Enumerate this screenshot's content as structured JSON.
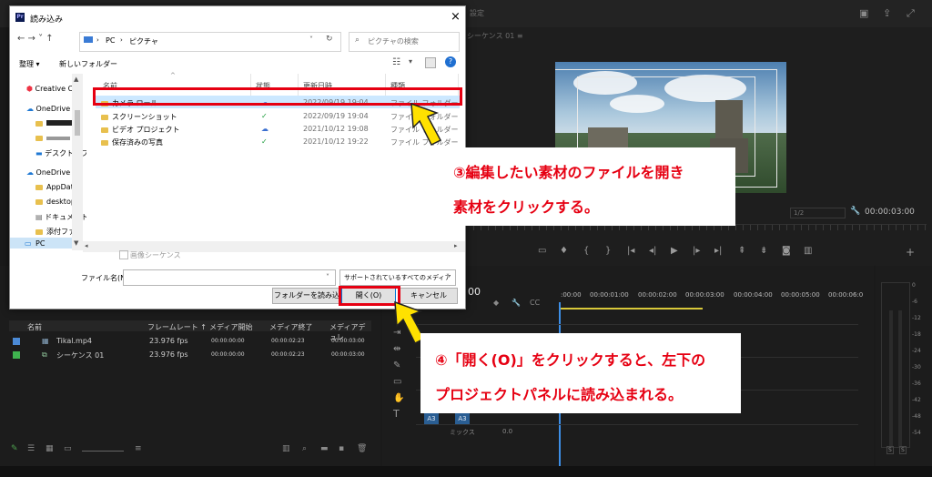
{
  "premiere": {
    "panel_title_faded": "設定",
    "sequence_tab": "シーケンス 01 ≡",
    "zoom_level": "1/2",
    "timecode": "00:00:03:00",
    "timeline_timecode": "00",
    "ruler": [
      ":00:00",
      "00:00:01:00",
      "00:00:02:00",
      "00:00:03:00",
      "00:00:04:00",
      "00:00:05:00",
      "00:00:06:0"
    ],
    "meter_labels": [
      "0",
      "-6",
      "-12",
      "-18",
      "-24",
      "-30",
      "-36",
      "-42",
      "-48",
      "-54"
    ],
    "meter_solo": [
      "S",
      "S"
    ],
    "track_labels": [
      "A3",
      "A3"
    ],
    "mix_label": "ミックス",
    "mix_value": "0.0",
    "project_columns": [
      "名前",
      "フレームレート ↑",
      "メディア開始",
      "メディア終了",
      "メディアデュレ"
    ],
    "project_rows": [
      {
        "name": "Tikal.mp4",
        "fps": "23.976 fps",
        "start": "00:00:00:00",
        "end": "00:00:02:23",
        "dur": "00:00:03:00",
        "color": "#4b8ad6"
      },
      {
        "name": "シーケンス 01",
        "fps": "23.976 fps",
        "start": "00:00:00:00",
        "end": "00:00:02:23",
        "dur": "00:00:03:00",
        "color": "#3fb34f"
      }
    ]
  },
  "dialog": {
    "title": "読み込み",
    "app_badge": "Pr",
    "close": "×",
    "nav_arrows": "← → ˅ ↑",
    "breadcrumb": [
      "PC",
      "ピクチャ"
    ],
    "breadcrumb_sep": "›",
    "search_placeholder": "ピクチャの検索",
    "organize": "整理 ▾",
    "new_folder": "新しいフォルダー",
    "nav_items": [
      "Creative Clo",
      "OneDrive - ",
      "",
      "",
      "デスクトップ",
      "OneDrive - ",
      "AppData",
      "desktop",
      "ドキュメント",
      "添付ファイ",
      "PC"
    ],
    "columns": [
      "名前",
      "状態",
      "更新日時",
      "種類"
    ],
    "files": [
      {
        "name": "カメラ ロール",
        "status": "☁",
        "date": "2022/09/19 19:04",
        "type": "ファイル フォルダー"
      },
      {
        "name": "スクリーンショット",
        "status": "✓",
        "date": "2022/09/19 19:04",
        "type": "ファイル フォルダー"
      },
      {
        "name": "ビデオ プロジェクト",
        "status": "☁",
        "date": "2021/10/12 19:08",
        "type": "ファイル フォルダー"
      },
      {
        "name": "保存済みの写真",
        "status": "✓",
        "date": "2021/10/12 19:22",
        "type": "ファイル フォルダー"
      }
    ],
    "image_sequence": "画像シーケンス",
    "filename_label": "ファイル名(N):",
    "filename_value": "",
    "filetype": "サポートされているすべてのメディア (*",
    "folder_import": "フォルダーを読み込み",
    "open": "開く(O)",
    "cancel": "キャンセル"
  },
  "annotations": {
    "step3_line1": "③編集したい素材のファイルを開き",
    "step3_line2": "素材をクリックする。",
    "step4_line1": "④「開く(O)」をクリックすると、左下の",
    "step4_line2": "プロジェクトパネルに読み込まれる。",
    "accent": "#e60012",
    "arrow_color": "#ffe100"
  }
}
